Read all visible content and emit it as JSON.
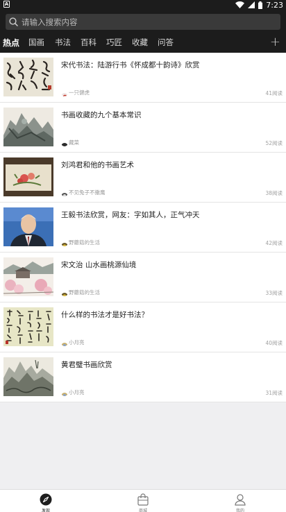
{
  "status_bar": {
    "left_icon_text": "A",
    "time": "7:23"
  },
  "search": {
    "placeholder": "请输入搜索内容"
  },
  "tabs": [
    {
      "label": "热点",
      "active": true
    },
    {
      "label": "国画",
      "active": false
    },
    {
      "label": "书法",
      "active": false
    },
    {
      "label": "百科",
      "active": false
    },
    {
      "label": "巧匠",
      "active": false
    },
    {
      "label": "收藏",
      "active": false
    },
    {
      "label": "问答",
      "active": false
    }
  ],
  "tab_add_label": "+",
  "articles": [
    {
      "title": "宋代书法：陆游行书《怀成都十韵诗》欣赏",
      "author": "一只健虎",
      "reads": "41阅读"
    },
    {
      "title": "书画收藏的九个基本常识",
      "author": "藏菜",
      "reads": "52阅读"
    },
    {
      "title": "刘鸿君和他的书画艺术",
      "author": "不见兔子不撒鹰",
      "reads": "38阅读"
    },
    {
      "title": "王毅书法欣赏，网友：字如其人，正气冲天",
      "author": "野蘑菇的生活",
      "reads": "42阅读"
    },
    {
      "title": "宋文治 山水画桃源仙境",
      "author": "野蘑菇的生活",
      "reads": "33阅读"
    },
    {
      "title": "什么样的书法才是好书法？",
      "author": "小月亮",
      "reads": "40阅读"
    },
    {
      "title": "黄君璧书画欣赏",
      "author": "小月亮",
      "reads": "31阅读"
    }
  ],
  "bottom_nav": [
    {
      "label": "发现",
      "icon": "discover-icon",
      "active": true
    },
    {
      "label": "商城",
      "icon": "shop-bag-icon",
      "active": false
    },
    {
      "label": "我的",
      "icon": "profile-icon",
      "active": false
    }
  ],
  "colors": {
    "header": "#1c1c1c",
    "background": "#efeff1",
    "card": "#ffffff",
    "muted_text": "#9a9a9a"
  }
}
